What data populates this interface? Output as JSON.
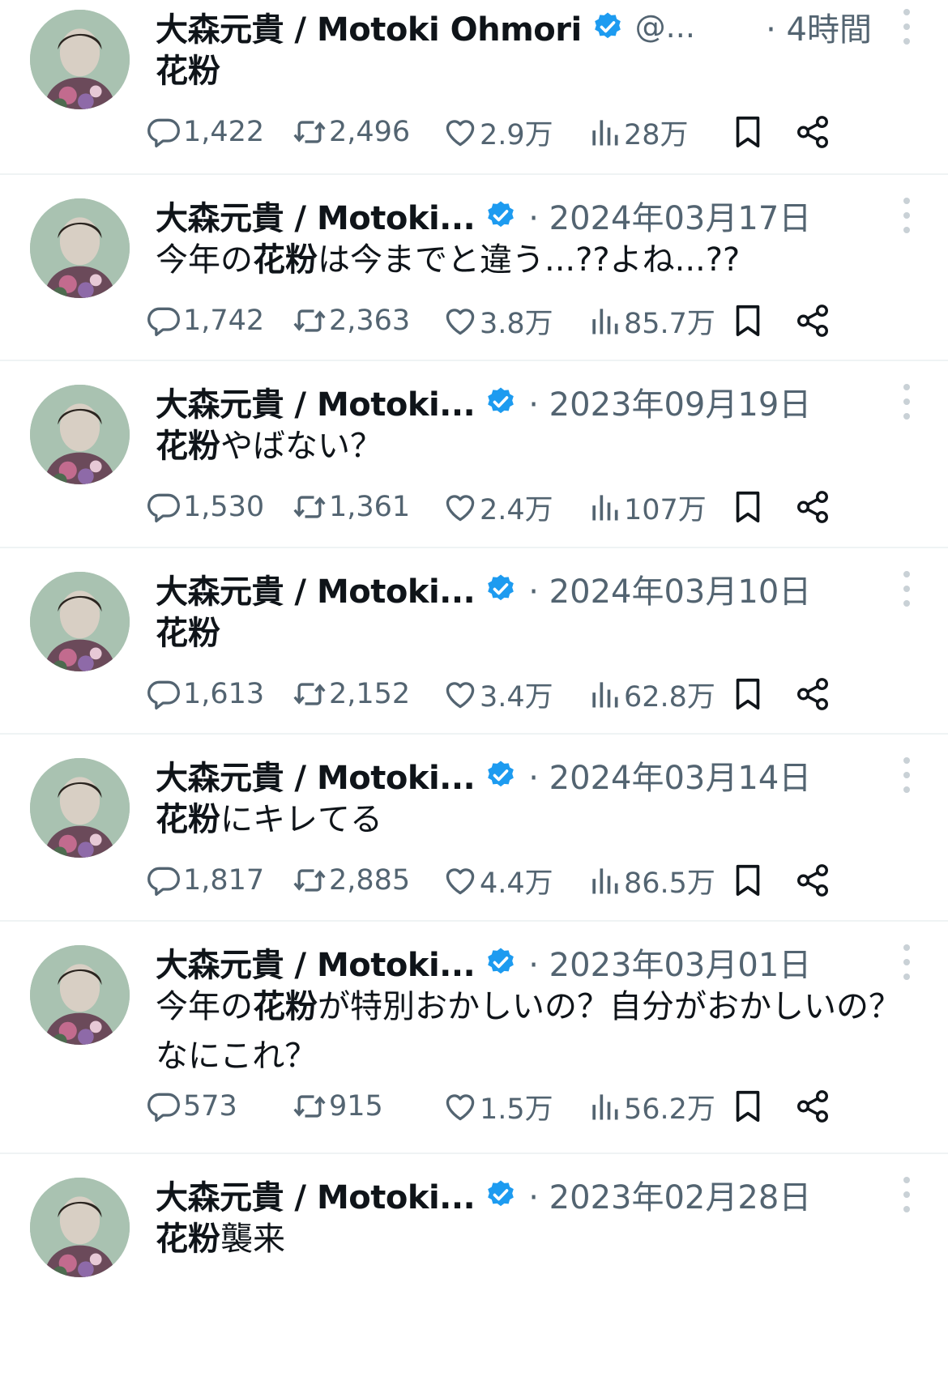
{
  "display_name": "大森元貴 / Motoki Ohmori",
  "display_name_truncated": "大森元貴 / Motoki...",
  "handle_truncated": "@...",
  "colors": {
    "verified": "#1d9bf0",
    "secondary_text": "#536471",
    "divider": "#eff3f4"
  },
  "icons": {
    "reply": "reply-icon",
    "retweet": "retweet-icon",
    "like": "heart-icon",
    "views": "views-icon",
    "bookmark": "bookmark-icon",
    "share": "share-icon",
    "more": "more-icon",
    "verified": "verified-badge-icon"
  },
  "tweets": [
    {
      "time": "· 4時間",
      "text_bold": "花粉",
      "text_rest": "",
      "text_prefix": "",
      "replies": "1,422",
      "retweets": "2,496",
      "likes": "2.9万",
      "views": "28万"
    },
    {
      "time": "· 2024年03月17日",
      "text_prefix": "今年の",
      "text_bold": "花粉",
      "text_rest": "は今までと違う...??よね...??",
      "replies": "1,742",
      "retweets": "2,363",
      "likes": "3.8万",
      "views": "85.7万"
    },
    {
      "time": "· 2023年09月19日",
      "text_prefix": "",
      "text_bold": "花粉",
      "text_rest": "やばない？",
      "replies": "1,530",
      "retweets": "1,361",
      "likes": "2.4万",
      "views": "107万"
    },
    {
      "time": "· 2024年03月10日",
      "text_prefix": "",
      "text_bold": "花粉",
      "text_rest": "",
      "replies": "1,613",
      "retweets": "2,152",
      "likes": "3.4万",
      "views": "62.8万"
    },
    {
      "time": "· 2024年03月14日",
      "text_prefix": "",
      "text_bold": "花粉",
      "text_rest": "にキレてる",
      "replies": "1,817",
      "retweets": "2,885",
      "likes": "4.4万",
      "views": "86.5万"
    },
    {
      "time": "· 2023年03月01日",
      "text_prefix": "今年の",
      "text_bold": "花粉",
      "text_rest": "が特別おかしいの？自分がおかしいの？なにこれ？",
      "replies": "573",
      "retweets": "915",
      "likes": "1.5万",
      "views": "56.2万"
    },
    {
      "time": "· 2023年02月28日",
      "text_prefix": "",
      "text_bold": "花粉",
      "text_rest": "襲来"
    }
  ]
}
